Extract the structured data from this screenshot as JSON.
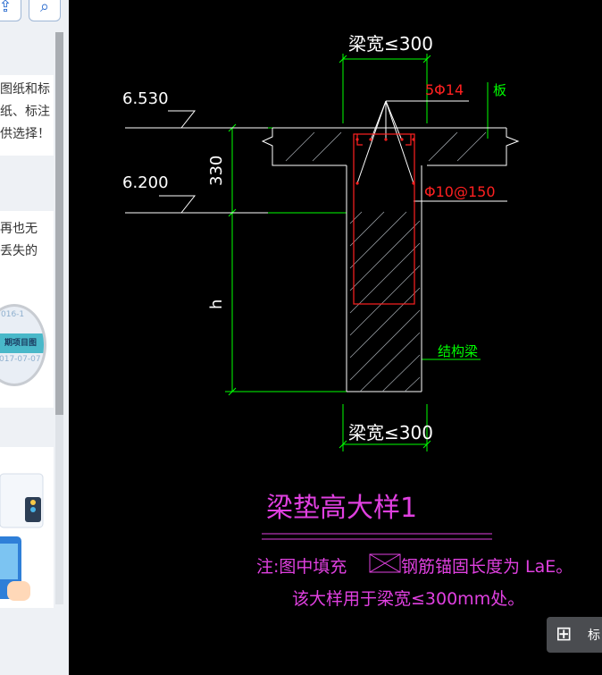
{
  "left_panel": {
    "top_buttons": {
      "share_icon": "share-icon",
      "search_icon": "search-icon",
      "share_glyph": "⇪",
      "search_glyph": "⌕"
    },
    "card1": {
      "lines": [
        "图纸和标",
        "纸、标注",
        "供选择！"
      ]
    },
    "card2": {
      "lines": [
        "再也无",
        "丢失的"
      ]
    },
    "thumbnail": {
      "date_top": "016-1",
      "band_text": "期项目图",
      "date_bottom": "017-07-07"
    }
  },
  "drawing": {
    "beam_width_top": "梁宽≤300",
    "beam_width_bottom": "梁宽≤300",
    "rebar_main": "5Φ14",
    "slab_label": "板",
    "stirrup": "Φ10@150",
    "elevation_top": "6.530",
    "elevation_bottom": "6.200",
    "dim_330": "330",
    "dim_h": "h",
    "structural_beam": "结构梁",
    "title": "梁垫高大样1",
    "note_line1_prefix": "注:图中填充",
    "note_line1_suffix": "钢筋锚固长度为 LaE。",
    "note_line2": "该大样用于梁宽≤300mm处。"
  },
  "float_button": {
    "icon": "grid-icon",
    "icon_glyph": "⊞",
    "label": "标"
  },
  "colors": {
    "canvas_bg": "#000000",
    "line_white": "#ffffff",
    "line_green": "#00ff00",
    "red": "#ff2020",
    "magenta": "#e040e0",
    "panel_bg": "#eef1f5"
  }
}
